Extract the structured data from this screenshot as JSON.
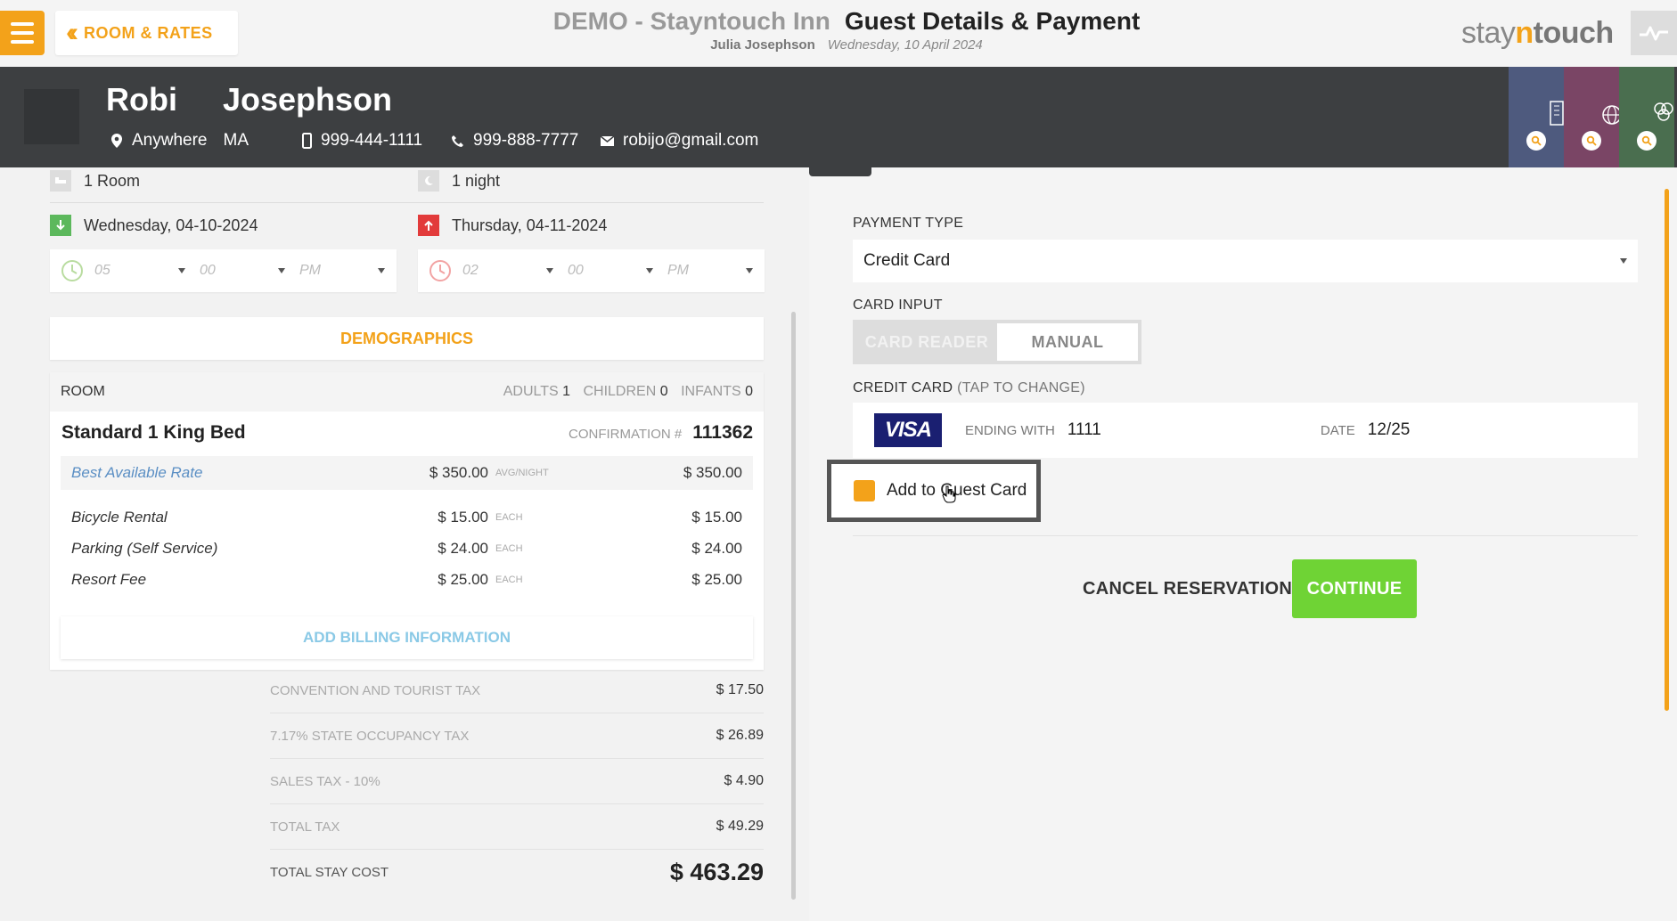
{
  "header": {
    "menu_icon": "hamburger-icon",
    "back_label": "ROOM & RATES",
    "hotel_name": "DEMO - Stayntouch Inn",
    "page_title": "Guest Details & Payment",
    "user_name": "Julia Josephson",
    "business_date": "Wednesday, 10 April 2024",
    "logo": {
      "stay": "stay",
      "n": "n",
      "touch": "touch"
    },
    "activity_icon": "activity-pulse-icon"
  },
  "guest": {
    "first_name": "Robi",
    "last_name": "Josephson",
    "city": "Anywhere",
    "state": "MA",
    "mobile": "999-444-1111",
    "phone": "999-888-7777",
    "email": "robijo@gmail.com",
    "side_tabs": [
      {
        "icon": "building-icon",
        "color": "#4e5a7e"
      },
      {
        "icon": "globe-icon",
        "color": "#7a4565"
      },
      {
        "icon": "group-icon",
        "color": "#4a6e4f"
      }
    ]
  },
  "stay": {
    "rooms": "1 Room",
    "nights": "1 night",
    "arrival": "Wednesday, 04-10-2024",
    "departure": "Thursday, 04-11-2024",
    "arrival_time": {
      "hour": "05",
      "minute": "00",
      "ampm": "PM"
    },
    "departure_time": {
      "hour": "02",
      "minute": "00",
      "ampm": "PM"
    }
  },
  "demographics_label": "DEMOGRAPHICS",
  "room": {
    "header_label": "ROOM",
    "adults_label": "ADULTS",
    "adults": "1",
    "children_label": "CHILDREN",
    "children": "0",
    "infants_label": "INFANTS",
    "infants": "0",
    "type": "Standard 1 King Bed",
    "confirmation_label": "CONFIRMATION #",
    "confirmation": "111362",
    "rate": {
      "name": "Best Available Rate",
      "amount": "$ 350.00",
      "unit": "AVG/NIGHT",
      "total": "$ 350.00"
    },
    "addons": [
      {
        "name": "Bicycle Rental",
        "amount": "$ 15.00",
        "unit": "EACH",
        "total": "$ 15.00"
      },
      {
        "name": "Parking (Self Service)",
        "amount": "$ 24.00",
        "unit": "EACH",
        "total": "$ 24.00"
      },
      {
        "name": "Resort Fee",
        "amount": "$ 25.00",
        "unit": "EACH",
        "total": "$ 25.00"
      }
    ],
    "add_billing_label": "ADD BILLING INFORMATION"
  },
  "taxes": [
    {
      "label": "CONVENTION AND TOURIST TAX",
      "value": "$ 17.50"
    },
    {
      "label": "7.17% STATE OCCUPANCY TAX",
      "value": "$ 26.89"
    },
    {
      "label": "SALES TAX - 10%",
      "value": "$ 4.90"
    },
    {
      "label": "TOTAL TAX",
      "value": "$ 49.29"
    },
    {
      "label": "TOTAL STAY COST",
      "value": "$ 463.29"
    }
  ],
  "payment": {
    "type_label": "PAYMENT TYPE",
    "type_value": "Credit Card",
    "card_input_label": "CARD INPUT",
    "card_reader_label": "CARD READER",
    "manual_label": "MANUAL",
    "credit_card_label": "CREDIT CARD",
    "tap_to_change": "(TAP TO CHANGE)",
    "card_brand": "VISA",
    "ending_label": "ENDING WITH",
    "ending": "1111",
    "date_label": "DATE",
    "date": "12/25",
    "add_guest_card_label": "Add to Guest Card",
    "cancel_label": "CANCEL RESERVATION",
    "continue_label": "CONTINUE"
  },
  "colors": {
    "accent": "#f3a21a",
    "continue": "#6fd335",
    "header_dark": "#3d3f41",
    "visa": "#1a1f71"
  }
}
